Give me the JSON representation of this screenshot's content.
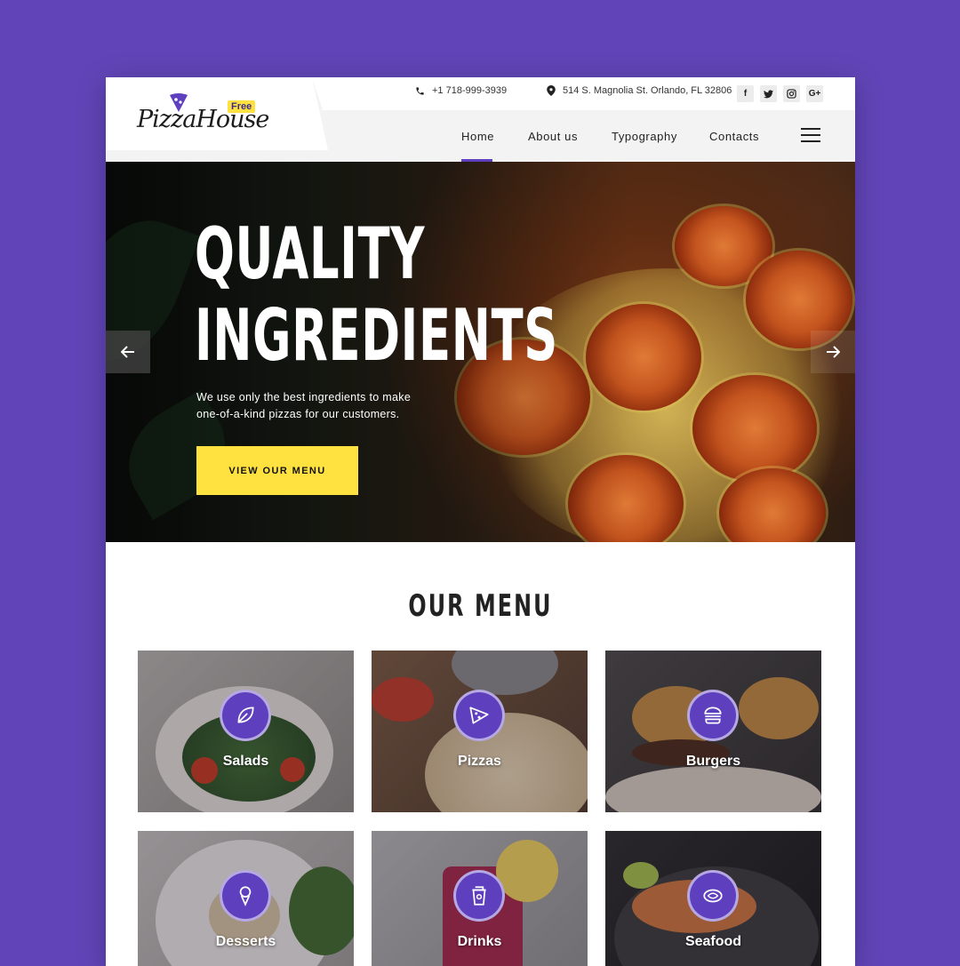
{
  "brand": {
    "logo_text": "PizzaHouse",
    "badge": "Free",
    "accent": "#5e3fbe",
    "highlight": "#ffe23f",
    "background": "#6145b8"
  },
  "topbar": {
    "phone": "+1 718-999-3939",
    "address": "514 S. Magnolia St. Orlando, FL 32806",
    "social": [
      {
        "icon": "facebook-icon",
        "glyph": "f"
      },
      {
        "icon": "twitter-icon",
        "glyph": "t"
      },
      {
        "icon": "instagram-icon",
        "glyph": "i"
      },
      {
        "icon": "google-plus-icon",
        "glyph": "G+"
      }
    ]
  },
  "nav": {
    "items": [
      {
        "label": "Home"
      },
      {
        "label": "About us"
      },
      {
        "label": "Typography"
      },
      {
        "label": "Contacts"
      }
    ],
    "active": "Home"
  },
  "hero": {
    "title_line1": "QUALITY",
    "title_line2": "INGREDIENTS",
    "description": "We use only the best ingredients to make one-of-a-kind pizzas for our customers.",
    "button": "VIEW OUR MENU"
  },
  "menu": {
    "title": "OUR MENU",
    "items": [
      {
        "label": "Salads",
        "icon": "leaf-icon"
      },
      {
        "label": "Pizzas",
        "icon": "pizza-slice-icon"
      },
      {
        "label": "Burgers",
        "icon": "burger-icon"
      },
      {
        "label": "Desserts",
        "icon": "ice-cream-icon"
      },
      {
        "label": "Drinks",
        "icon": "cup-icon"
      },
      {
        "label": "Seafood",
        "icon": "fish-steak-icon"
      }
    ]
  }
}
